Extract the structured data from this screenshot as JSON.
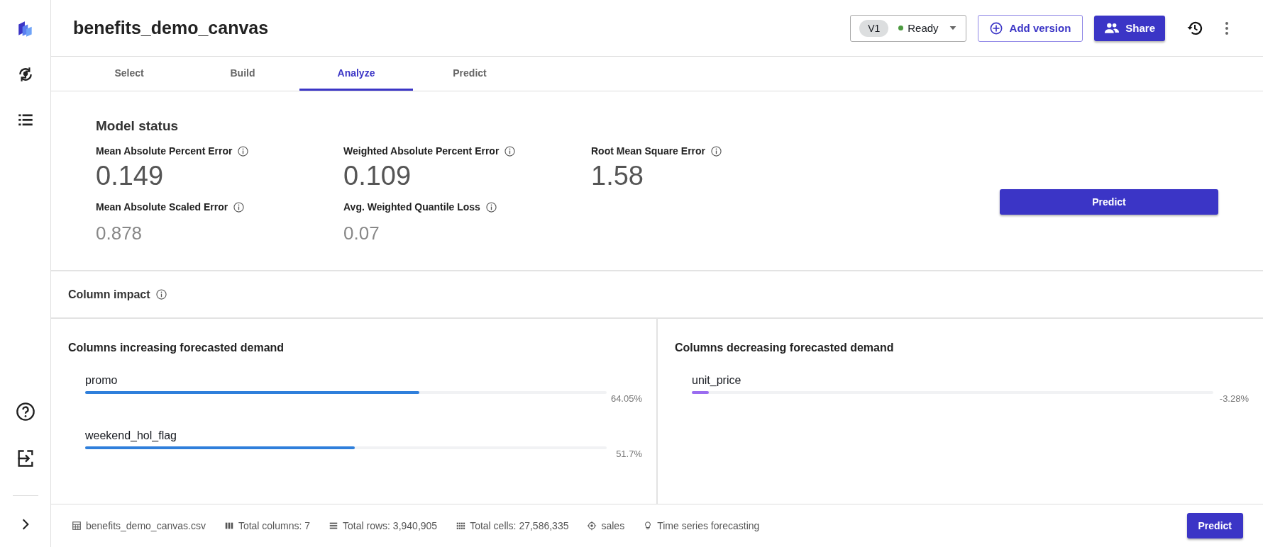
{
  "header": {
    "title": "benefits_demo_canvas",
    "version": {
      "badge": "V1",
      "status": "Ready"
    },
    "add_version": "Add version",
    "share": "Share"
  },
  "tabs": [
    {
      "label": "Select",
      "selected": false
    },
    {
      "label": "Build",
      "selected": false
    },
    {
      "label": "Analyze",
      "selected": true
    },
    {
      "label": "Predict",
      "selected": false
    }
  ],
  "model_status": {
    "title": "Model status",
    "predict_button": "Predict",
    "metrics": [
      {
        "label": "Mean Absolute Percent Error",
        "value": "0.149",
        "kind": "primary"
      },
      {
        "label": "Weighted Absolute Percent Error",
        "value": "0.109",
        "kind": "primary"
      },
      {
        "label": "Root Mean Square Error",
        "value": "1.58",
        "kind": "primary"
      },
      {
        "label": "Mean Absolute Scaled Error",
        "value": "0.878",
        "kind": "secondary"
      },
      {
        "label": "Avg. Weighted Quantile Loss",
        "value": "0.07",
        "kind": "secondary"
      }
    ]
  },
  "column_impact": {
    "title": "Column impact",
    "panels": [
      {
        "title": "Columns increasing forecasted demand",
        "items": [
          {
            "name": "promo",
            "level": 0.6405,
            "reading": "64.05%",
            "color": "#2f7fdb"
          },
          {
            "name": "weekend_hol_flag",
            "level": 0.517,
            "reading": "51.7%",
            "color": "#2f7fdb"
          }
        ]
      },
      {
        "title": "Columns decreasing forecasted demand",
        "items": [
          {
            "name": "unit_price",
            "level": 0.0328,
            "reading": "-3.28%",
            "color": "#9a6cf0"
          }
        ]
      }
    ]
  },
  "status_bar": {
    "items": [
      {
        "kind": "file",
        "text": "benefits_demo_canvas.csv"
      },
      {
        "kind": "columns",
        "text": "Total columns: 7"
      },
      {
        "kind": "rows",
        "text": "Total rows: 3,940,905"
      },
      {
        "kind": "cells",
        "text": "Total cells: 27,586,335"
      },
      {
        "kind": "target",
        "text": "sales"
      },
      {
        "kind": "idea",
        "text": "Time series forecasting"
      }
    ],
    "predict_button": "Predict"
  }
}
